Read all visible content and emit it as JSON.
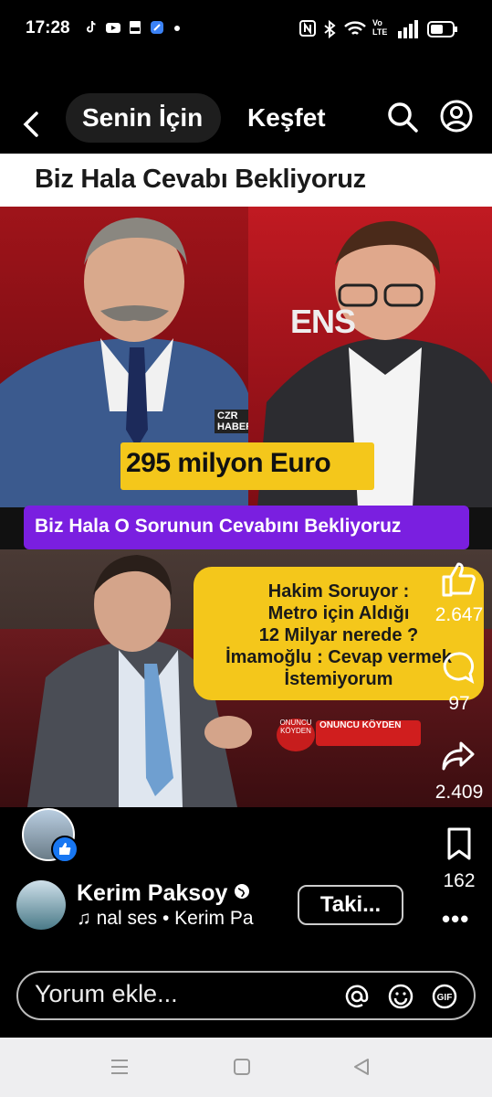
{
  "status_bar": {
    "time": "17:28",
    "icons": [
      "tiktok-icon",
      "youtube-icon",
      "pdf-icon",
      "app-icon",
      "dot",
      "nfc-icon",
      "bluetooth-icon",
      "wifi-icon",
      "volte-icon",
      "signal-icon",
      "battery-icon"
    ],
    "volte_label": "Vo LTE"
  },
  "nav": {
    "tabs": [
      {
        "label": "Senin İçin",
        "active": true
      },
      {
        "label": "Keşfet",
        "active": false
      }
    ]
  },
  "video": {
    "title": "Biz Hala Cevabı Bekliyoruz",
    "banner_amount": "295 milyon Euro",
    "purple_caption": "Biz Hala O Sorunun Cevabını Bekliyoruz",
    "channel_bug": "CZR HABER",
    "studio_sign": "ENS",
    "quote_lines": [
      "Hakim Soruyor :",
      "Metro için Aldığı",
      "12 Milyar nerede ?",
      "İmamoğlu : Cevap vermek",
      "İstemiyorum"
    ],
    "watermark_logo": "ONUNCU KÖYDEN",
    "watermark_label": "ONUNCU KÖYDEN"
  },
  "rail": {
    "likes": "2.647",
    "comments": "97",
    "shares": "2.409",
    "saves": "162"
  },
  "author": {
    "name": "Kerim Paksoy",
    "audio_text": "nal ses  •  Kerim Pa",
    "follow_label": "Taki..."
  },
  "comment": {
    "placeholder": "Yorum ekle..."
  },
  "colors": {
    "accent_like": "#1877f2",
    "banner_yellow": "#f4c71b",
    "caption_purple": "#7a1fe0"
  }
}
